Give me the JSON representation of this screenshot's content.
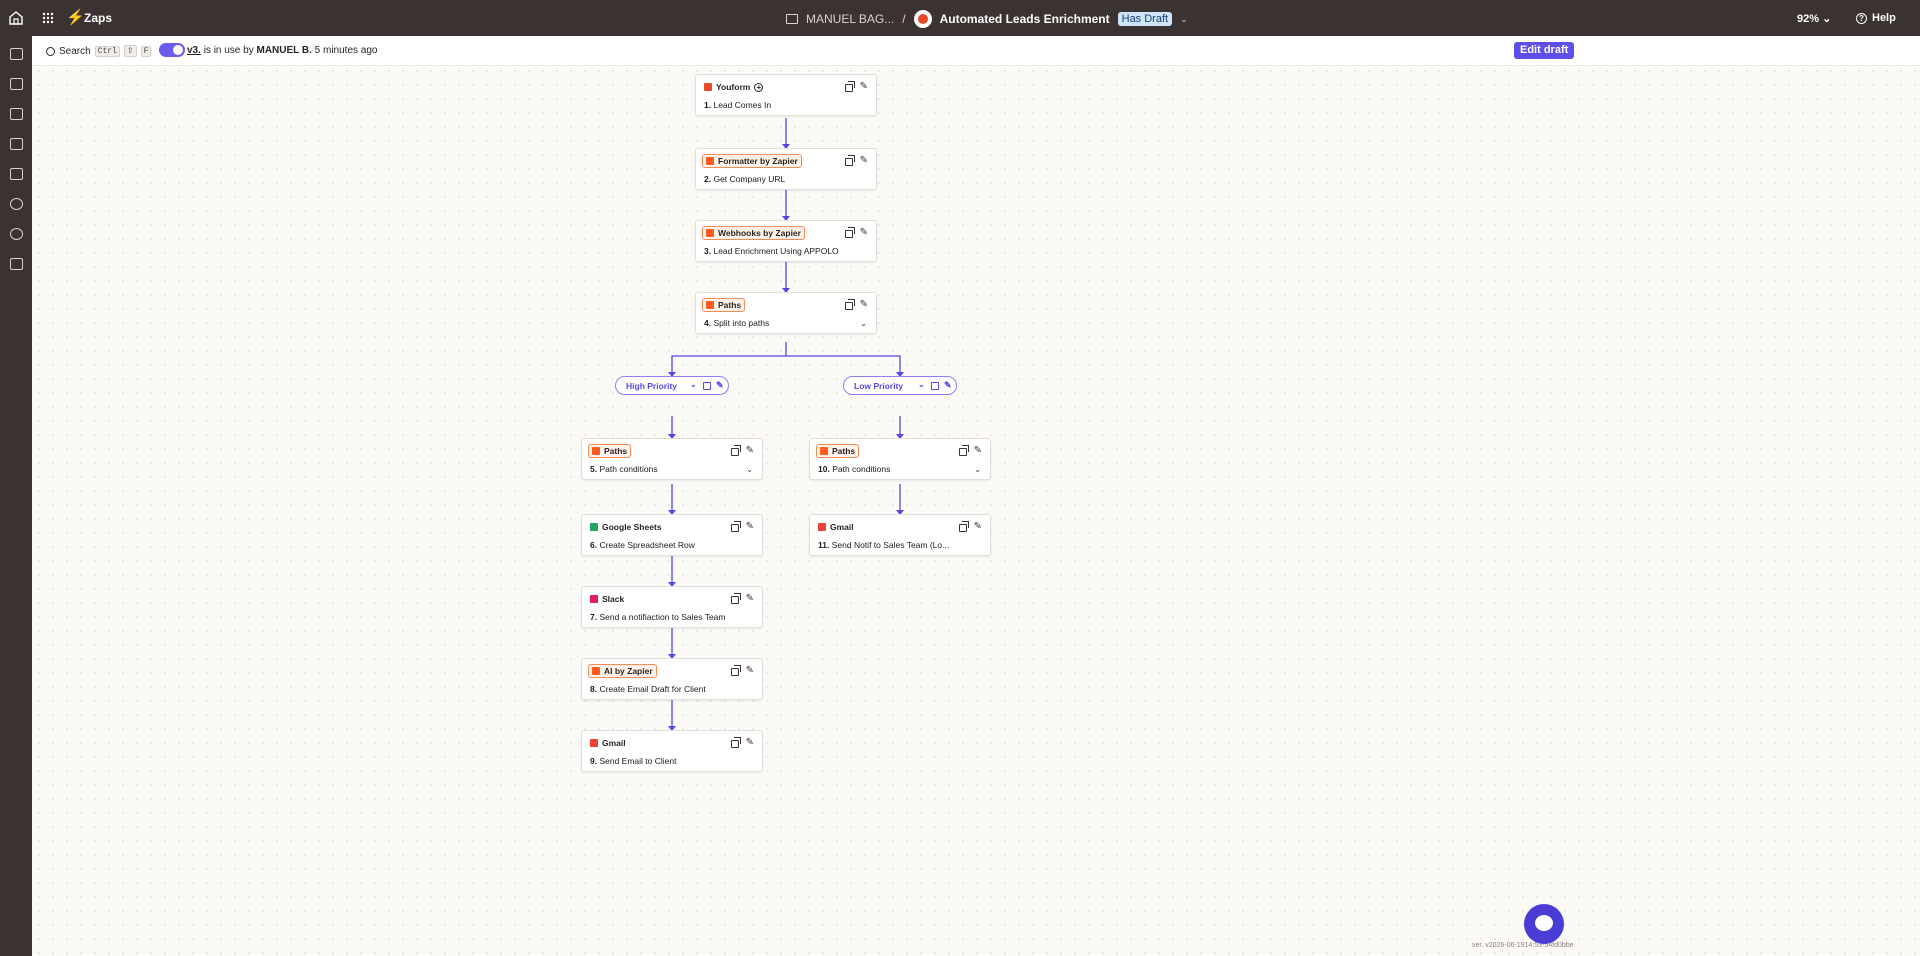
{
  "topbar": {
    "app_label": "Zaps",
    "folder": "MANUEL BAG...",
    "separator": "/",
    "zap_name": "Automated Leads Enrichment",
    "draft_badge": "Has Draft",
    "zoom": "92%",
    "help": "Help"
  },
  "subbar": {
    "search_label": "Search",
    "shortcut_keys": [
      "Ctrl",
      "⇧",
      "F"
    ],
    "version_link": "v3.",
    "status_text": "is in use by",
    "status_user": "MANUEL B.",
    "status_time": "5 minutes ago",
    "edit_button": "Edit draft"
  },
  "steps": [
    {
      "app": "Youform",
      "num": "1.",
      "title": "Lead Comes In",
      "logo_color": "#e8492a",
      "tagged": false
    },
    {
      "app": "Formatter by Zapier",
      "num": "2.",
      "title": "Get Company URL",
      "logo_color": "#ff5a1f",
      "tagged": true
    },
    {
      "app": "Webhooks by Zapier",
      "num": "3.",
      "title": "Lead Enrichment Using APPOLO",
      "logo_color": "#ff5a1f",
      "tagged": true
    },
    {
      "app": "Paths",
      "num": "4.",
      "title": "Split into paths",
      "logo_color": "#ff5a1f",
      "tagged": true
    },
    {
      "app": "Paths",
      "num": "5.",
      "title": "Path conditions",
      "logo_color": "#ff5a1f",
      "tagged": true
    },
    {
      "app": "Google Sheets",
      "num": "6.",
      "title": "Create Spreadsheet Row",
      "logo_color": "#21a464",
      "tagged": false
    },
    {
      "app": "Slack",
      "num": "7.",
      "title": "Send a notifiaction to Sales Team",
      "logo_color": "#e01e5a",
      "tagged": false
    },
    {
      "app": "AI by Zapier",
      "num": "8.",
      "title": "Create Email Draft for Client",
      "logo_color": "#ff5a1f",
      "tagged": true
    },
    {
      "app": "Gmail",
      "num": "9.",
      "title": "Send Email to Client",
      "logo_color": "#ea4335",
      "tagged": false
    },
    {
      "app": "Paths",
      "num": "10.",
      "title": "Path conditions",
      "logo_color": "#ff5a1f",
      "tagged": true
    },
    {
      "app": "Gmail",
      "num": "11.",
      "title": "Send Notif to Sales Team (Lo...",
      "logo_color": "#ea4335",
      "tagged": false
    }
  ],
  "paths": [
    {
      "label": "High Priority"
    },
    {
      "label": "Low Priority"
    }
  ],
  "footer": {
    "version": "ver. v2026-06-1914:53-54fd0bbe"
  },
  "colors": {
    "accent": "#5f4fea",
    "connector": "#5547e6",
    "brand": "#ff5a1f"
  }
}
